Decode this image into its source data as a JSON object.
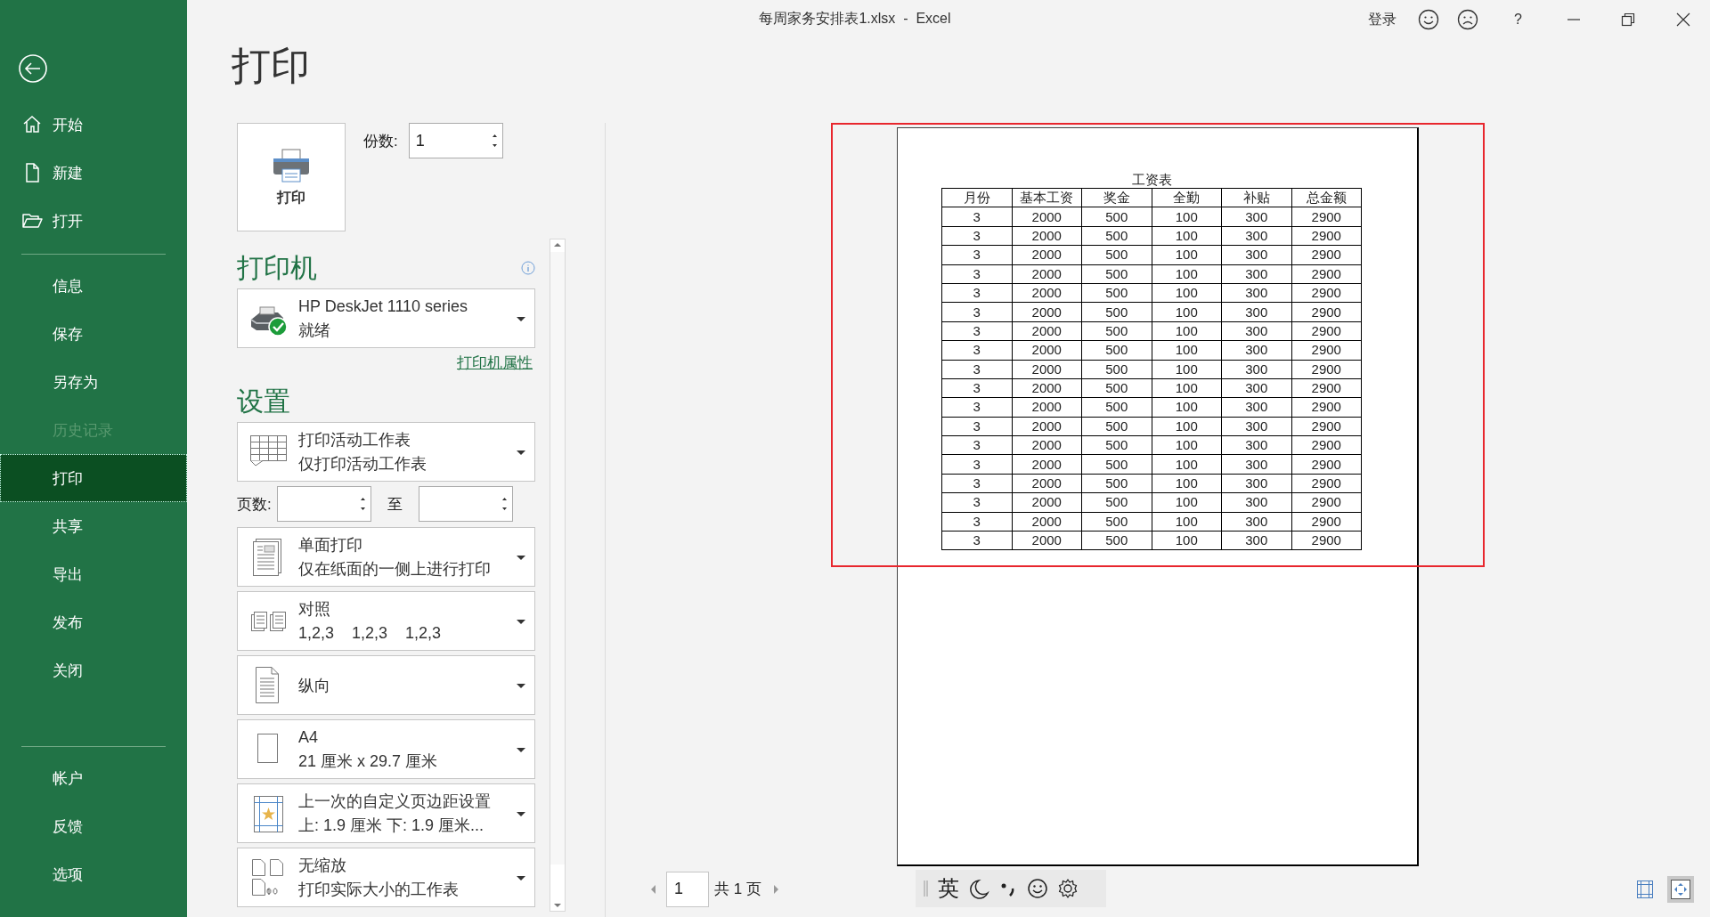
{
  "window": {
    "title": "每周家务安排表1.xlsx  -  Excel",
    "sign_in": "登录",
    "help": "?"
  },
  "sidebar": {
    "groups": [
      [
        {
          "kind": "home",
          "label": "开始",
          "selected": false,
          "disabled": false
        },
        {
          "kind": "new",
          "label": "新建",
          "selected": false,
          "disabled": false
        },
        {
          "kind": "open",
          "label": "打开",
          "selected": false,
          "disabled": false
        }
      ],
      [
        {
          "kind": "plain",
          "label": "信息",
          "selected": false,
          "disabled": false
        },
        {
          "kind": "plain",
          "label": "保存",
          "selected": false,
          "disabled": false
        },
        {
          "kind": "plain",
          "label": "另存为",
          "selected": false,
          "disabled": false
        },
        {
          "kind": "plain",
          "label": "历史记录",
          "selected": false,
          "disabled": true
        },
        {
          "kind": "plain",
          "label": "打印",
          "selected": true,
          "disabled": false
        },
        {
          "kind": "plain",
          "label": "共享",
          "selected": false,
          "disabled": false
        },
        {
          "kind": "plain",
          "label": "导出",
          "selected": false,
          "disabled": false
        },
        {
          "kind": "plain",
          "label": "发布",
          "selected": false,
          "disabled": false
        },
        {
          "kind": "plain",
          "label": "关闭",
          "selected": false,
          "disabled": false
        }
      ],
      [
        {
          "kind": "plain",
          "label": "帐户",
          "selected": false,
          "disabled": false
        },
        {
          "kind": "plain",
          "label": "反馈",
          "selected": false,
          "disabled": false
        },
        {
          "kind": "plain",
          "label": "选项",
          "selected": false,
          "disabled": false
        }
      ]
    ]
  },
  "print": {
    "heading": "打印",
    "button": "打印",
    "copies_label": "份数:",
    "copies": "1"
  },
  "printer": {
    "heading": "打印机",
    "name": "HP DeskJet 1110 series",
    "status": "就绪",
    "properties_link": "打印机属性"
  },
  "settings": {
    "heading": "设置",
    "scope": {
      "kind": "sheets",
      "title": "打印活动工作表",
      "detail": "仅打印活动工作表"
    },
    "pages": {
      "label": "页数:",
      "to": "至"
    },
    "options": [
      {
        "kind": "sides",
        "title": "单面打印",
        "detail": "仅在纸面的一侧上进行打印"
      },
      {
        "kind": "collate",
        "title": "对照",
        "detail": "1,2,3    1,2,3    1,2,3"
      },
      {
        "kind": "orientation",
        "title": "纵向"
      },
      {
        "kind": "paper",
        "title": "A4",
        "detail": "21 厘米 x 29.7 厘米"
      },
      {
        "kind": "margins",
        "title": "上一次的自定义页边距设置",
        "detail": "上: 1.9 厘米 下: 1.9 厘米..."
      },
      {
        "kind": "scaling",
        "title": "无缩放",
        "detail": "打印实际大小的工作表"
      }
    ]
  },
  "preview": {
    "title": "工资表",
    "columns": [
      "月份",
      "基本工资",
      "奖金",
      "全勤",
      "补贴",
      "总金额"
    ],
    "rows": [
      [
        "3",
        "2000",
        "500",
        "100",
        "300",
        "2900"
      ],
      [
        "3",
        "2000",
        "500",
        "100",
        "300",
        "2900"
      ],
      [
        "3",
        "2000",
        "500",
        "100",
        "300",
        "2900"
      ],
      [
        "3",
        "2000",
        "500",
        "100",
        "300",
        "2900"
      ],
      [
        "3",
        "2000",
        "500",
        "100",
        "300",
        "2900"
      ],
      [
        "3",
        "2000",
        "500",
        "100",
        "300",
        "2900"
      ],
      [
        "3",
        "2000",
        "500",
        "100",
        "300",
        "2900"
      ],
      [
        "3",
        "2000",
        "500",
        "100",
        "300",
        "2900"
      ],
      [
        "3",
        "2000",
        "500",
        "100",
        "300",
        "2900"
      ],
      [
        "3",
        "2000",
        "500",
        "100",
        "300",
        "2900"
      ],
      [
        "3",
        "2000",
        "500",
        "100",
        "300",
        "2900"
      ],
      [
        "3",
        "2000",
        "500",
        "100",
        "300",
        "2900"
      ],
      [
        "3",
        "2000",
        "500",
        "100",
        "300",
        "2900"
      ],
      [
        "3",
        "2000",
        "500",
        "100",
        "300",
        "2900"
      ],
      [
        "3",
        "2000",
        "500",
        "100",
        "300",
        "2900"
      ],
      [
        "3",
        "2000",
        "500",
        "100",
        "300",
        "2900"
      ],
      [
        "3",
        "2000",
        "500",
        "100",
        "300",
        "2900"
      ],
      [
        "3",
        "2000",
        "500",
        "100",
        "300",
        "2900"
      ]
    ]
  },
  "pager": {
    "page": "1",
    "total": "共 1 页"
  },
  "ime": {
    "mode": "英"
  }
}
